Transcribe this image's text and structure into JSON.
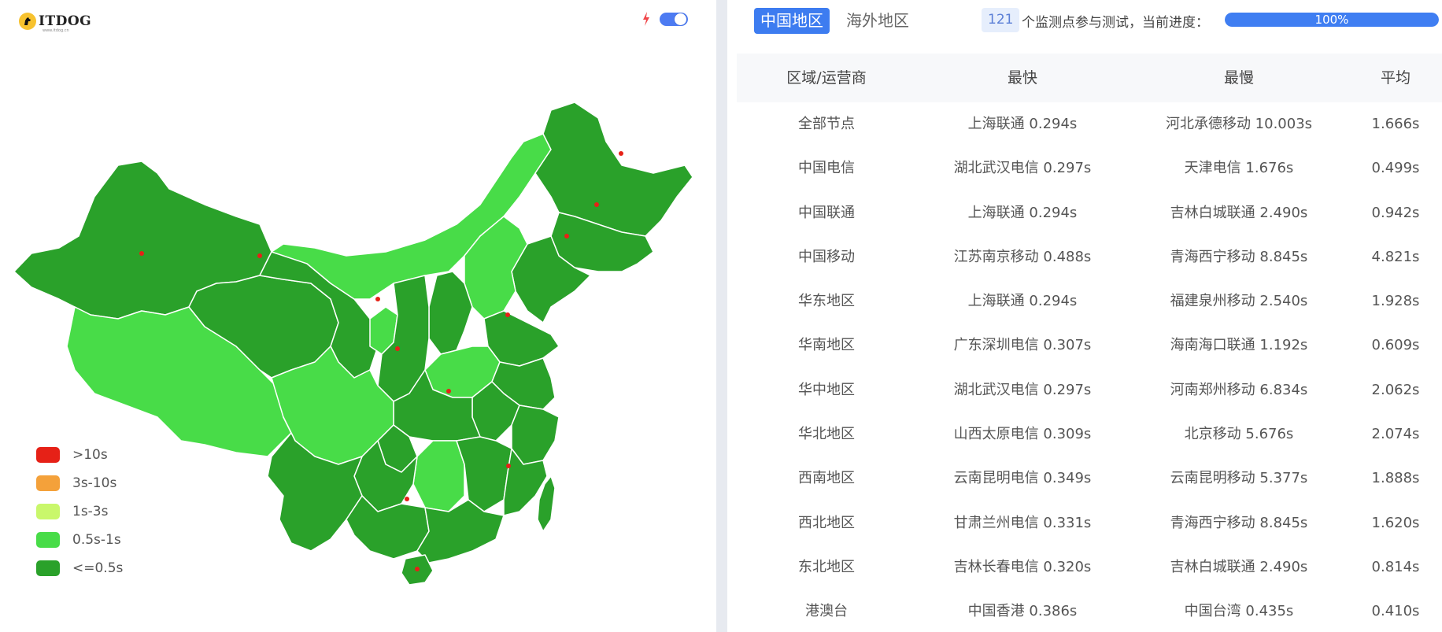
{
  "brand": {
    "name": "ITDOG",
    "sub": "www.itdog.cn"
  },
  "legend": [
    {
      "label": ">10s",
      "color": "#e62117"
    },
    {
      "label": "3s-10s",
      "color": "#f4a13a"
    },
    {
      "label": "1s-3s",
      "color": "#c9f76b"
    },
    {
      "label": "0.5s-1s",
      "color": "#48dc48"
    },
    {
      "label": "<=0.5s",
      "color": "#2aa12a"
    }
  ],
  "tabs": {
    "active": "中国地区",
    "inactive": "海外地区"
  },
  "status": {
    "count": "121",
    "text": "个监测点参与测试，当前进度：",
    "progress_label": "100%",
    "progress": 1.0
  },
  "table": {
    "headers": [
      "区域/运营商",
      "最快",
      "最慢",
      "平均"
    ],
    "rows": [
      [
        "全部节点",
        "上海联通 0.294s",
        "河北承德移动 10.003s",
        "1.666s"
      ],
      [
        "中国电信",
        "湖北武汉电信 0.297s",
        "天津电信 1.676s",
        "0.499s"
      ],
      [
        "中国联通",
        "上海联通 0.294s",
        "吉林白城联通 2.490s",
        "0.942s"
      ],
      [
        "中国移动",
        "江苏南京移动 0.488s",
        "青海西宁移动 8.845s",
        "4.821s"
      ],
      [
        "华东地区",
        "上海联通 0.294s",
        "福建泉州移动 2.540s",
        "1.928s"
      ],
      [
        "华南地区",
        "广东深圳电信 0.307s",
        "海南海口联通 1.192s",
        "0.609s"
      ],
      [
        "华中地区",
        "湖北武汉电信 0.297s",
        "河南郑州移动 6.834s",
        "2.062s"
      ],
      [
        "华北地区",
        "山西太原电信 0.309s",
        "北京移动 5.676s",
        "2.074s"
      ],
      [
        "西南地区",
        "云南昆明电信 0.349s",
        "云南昆明移动 5.377s",
        "1.888s"
      ],
      [
        "西北地区",
        "甘肃兰州电信 0.331s",
        "青海西宁移动 8.845s",
        "1.620s"
      ],
      [
        "东北地区",
        "吉林长春电信 0.320s",
        "吉林白城联通 2.490s",
        "0.814s"
      ],
      [
        "港澳台",
        "中国香港 0.386s",
        "中国台湾 0.435s",
        "0.410s"
      ]
    ]
  },
  "colors": {
    "accent": "#3d7cf0",
    "dark_green": "#2aa12a",
    "light_green": "#48dc48"
  }
}
